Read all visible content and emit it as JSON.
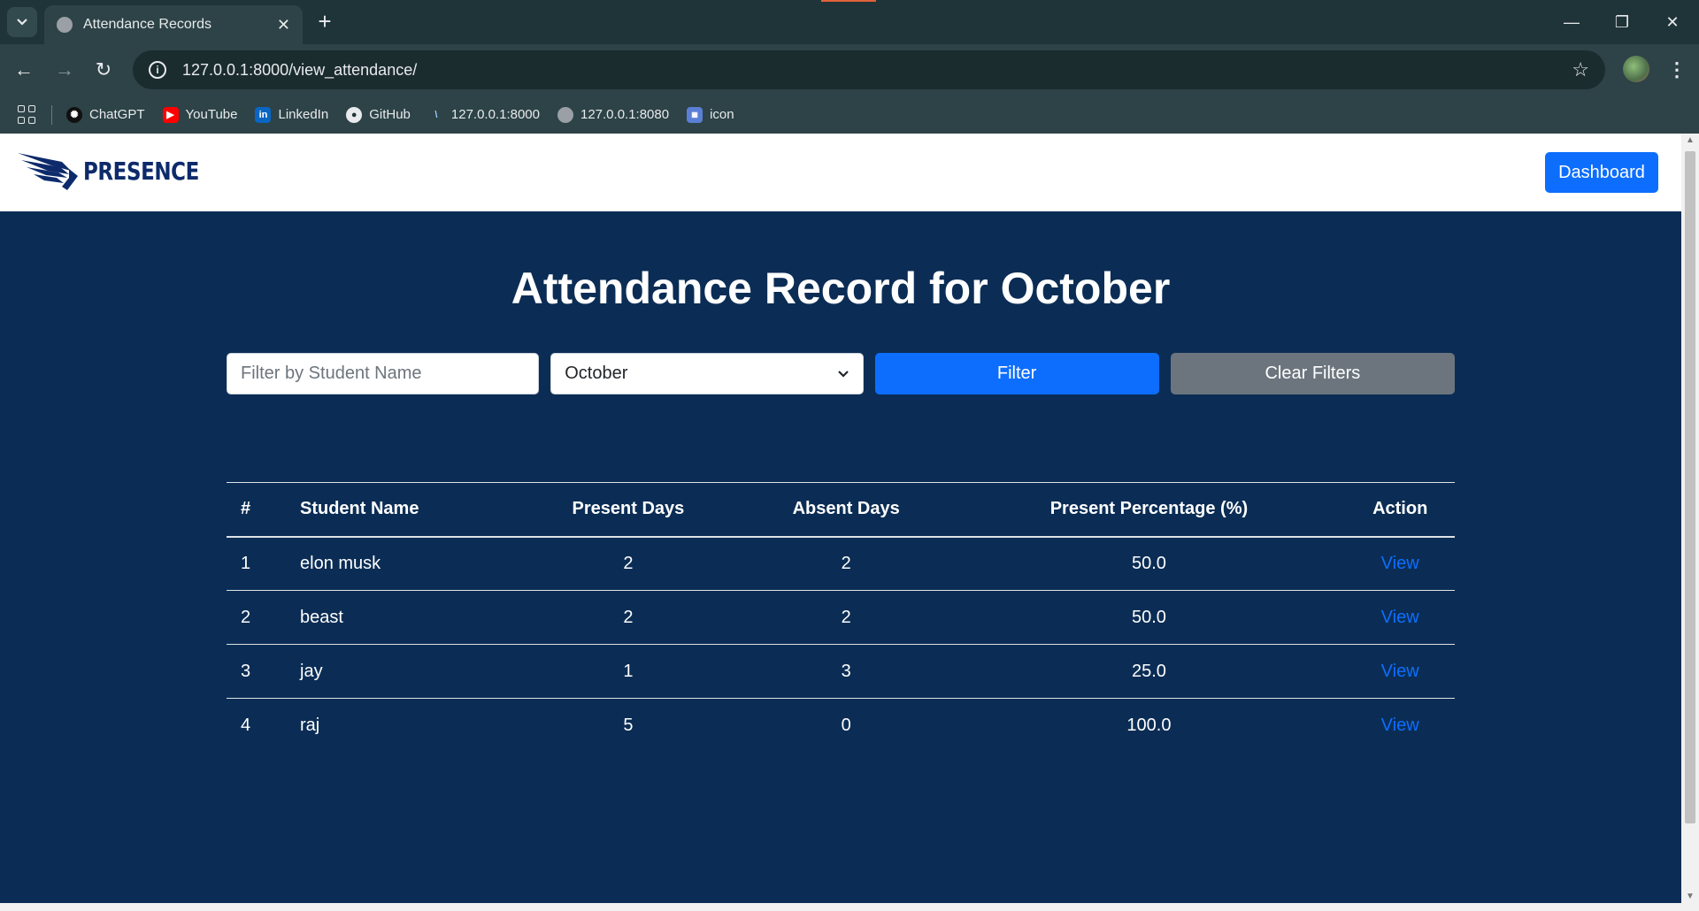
{
  "browser": {
    "tab_title": "Attendance Records",
    "tab_close": "✕",
    "new_tab": "+",
    "url": "127.0.0.1:8000/view_attendance/",
    "bookmarks": [
      {
        "label": "ChatGPT",
        "icon": "chatgpt-icon"
      },
      {
        "label": "YouTube",
        "icon": "youtube-icon"
      },
      {
        "label": "LinkedIn",
        "icon": "linkedin-icon"
      },
      {
        "label": "GitHub",
        "icon": "github-icon"
      },
      {
        "label": "127.0.0.1:8000",
        "icon": "vercel-icon"
      },
      {
        "label": "127.0.0.1:8080",
        "icon": "globe-icon"
      },
      {
        "label": "icon",
        "icon": "icon-bookmark-icon"
      }
    ]
  },
  "navbar": {
    "brand": "PRESENCE",
    "dashboard_label": "Dashboard"
  },
  "page": {
    "title": "Attendance Record for October"
  },
  "filters": {
    "name_placeholder": "Filter by Student Name",
    "name_value": "",
    "month_selected": "October",
    "filter_label": "Filter",
    "clear_label": "Clear Filters"
  },
  "table": {
    "headers": [
      "#",
      "Student Name",
      "Present Days",
      "Absent Days",
      "Present Percentage (%)",
      "Action"
    ],
    "rows": [
      {
        "num": "1",
        "name": "elon musk",
        "present": "2",
        "absent": "2",
        "percentage": "50.0",
        "action": "View"
      },
      {
        "num": "2",
        "name": "beast",
        "present": "2",
        "absent": "2",
        "percentage": "50.0",
        "action": "View"
      },
      {
        "num": "3",
        "name": "jay",
        "present": "1",
        "absent": "3",
        "percentage": "25.0",
        "action": "View"
      },
      {
        "num": "4",
        "name": "raj",
        "present": "5",
        "absent": "0",
        "percentage": "100.0",
        "action": "View"
      }
    ]
  },
  "colors": {
    "page_bg": "#0b2d55",
    "primary": "#0d6efd",
    "secondary": "#6c757d",
    "brand": "#0d2a6b"
  }
}
